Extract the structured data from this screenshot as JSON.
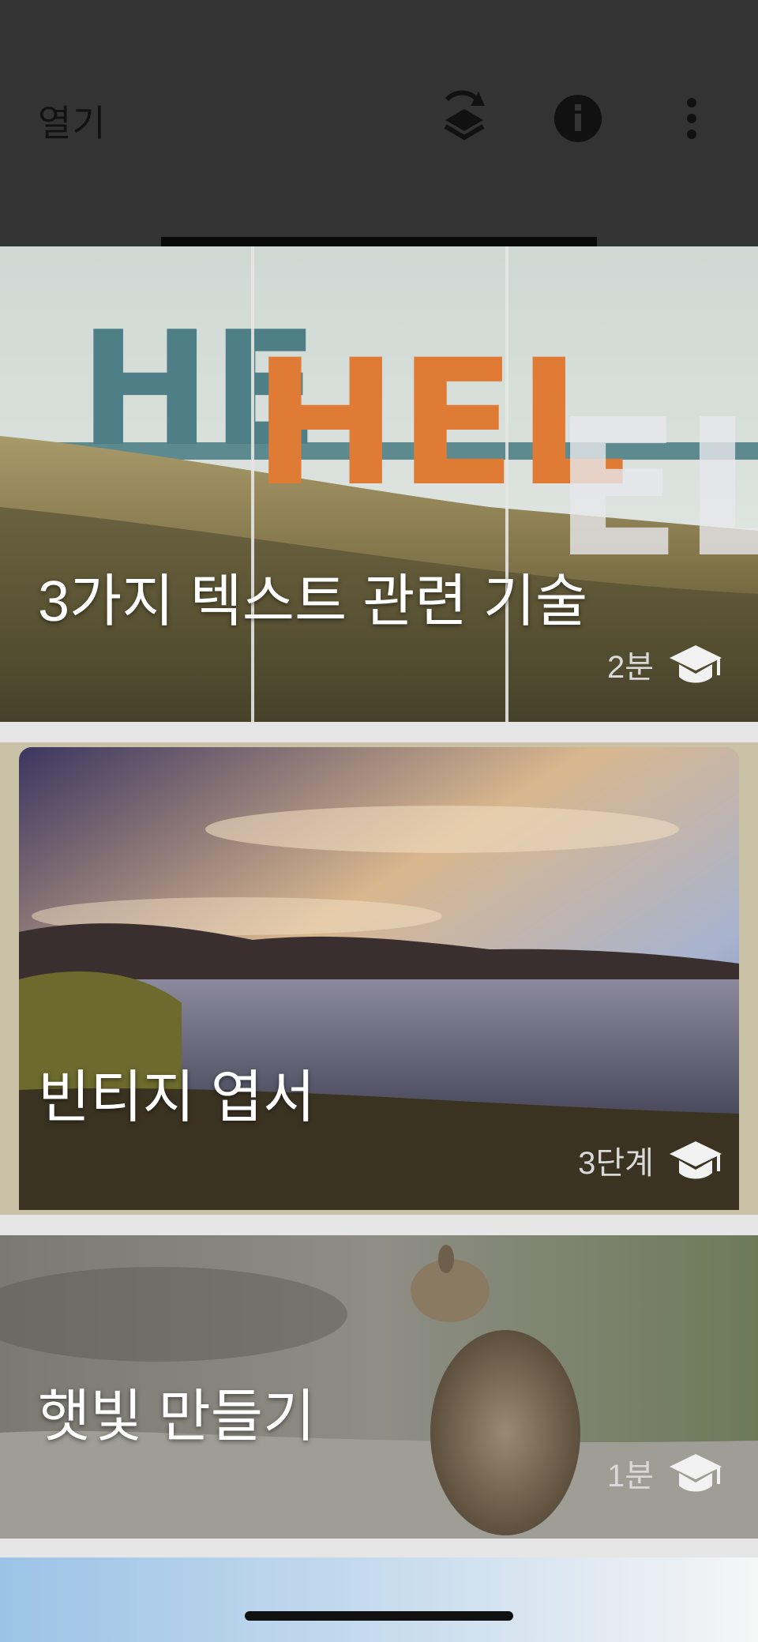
{
  "header": {
    "title": "열기",
    "icons": [
      "layers-refresh-icon",
      "info-icon",
      "more-vert-icon"
    ]
  },
  "cards": [
    {
      "title": "3가지 텍스트 관련 기술",
      "duration": "2분",
      "icon": "graduation-cap-icon"
    },
    {
      "title": "빈티지 엽서",
      "duration": "3단계",
      "icon": "graduation-cap-icon"
    },
    {
      "title": "햇빛 만들기",
      "duration": "1분",
      "icon": "graduation-cap-icon"
    }
  ],
  "card1_overlay_text": [
    "HE",
    "HEL",
    "EL"
  ],
  "colors": {
    "header_bg": "#333333",
    "orange_text": "#e07b35",
    "teal_text": "#4f7f86",
    "page_bg": "#e6e6e6"
  }
}
